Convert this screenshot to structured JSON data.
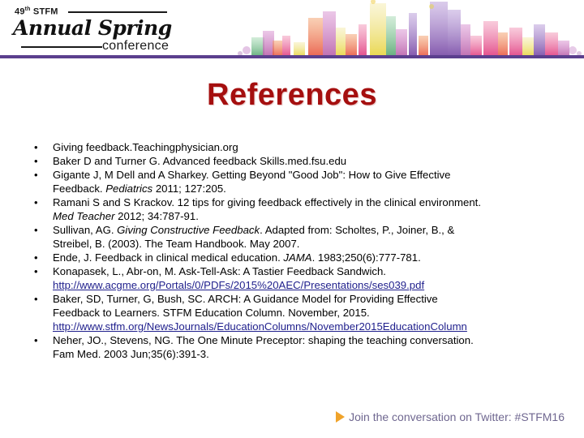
{
  "header": {
    "logo": {
      "ordinal": "49",
      "ordinal_suffix": "th",
      "org": "STFM",
      "script": "Annual Spring",
      "conference": "conference"
    },
    "graphic_name": "watercolor-city-skyline",
    "rule_color": "#5b3f8e"
  },
  "slide": {
    "title": "References",
    "title_color": "#a50f0f"
  },
  "references": [
    {
      "bullet": "•",
      "lines": [
        [
          {
            "text": "Giving  feedback.Teachingphysician.org",
            "style": "plain"
          }
        ]
      ]
    },
    {
      "bullet": "•",
      "lines": [
        [
          {
            "text": "Baker D and Turner G. Advanced feedback Skills.med.fsu.edu",
            "style": "plain"
          }
        ]
      ]
    },
    {
      "bullet": "•",
      "lines": [
        [
          {
            "text": "Gigante J, M Dell and A Sharkey. Getting Beyond \"Good Job\": How to Give Effective",
            "style": "plain"
          }
        ],
        [
          {
            "text": "Feedback. ",
            "style": "plain"
          },
          {
            "text": "Pediatrics",
            "style": "italic"
          },
          {
            "text": " 2011; 127:205.",
            "style": "plain"
          }
        ]
      ]
    },
    {
      "bullet": "•",
      "lines": [
        [
          {
            "text": "Ramani S and S Krackov. 12 tips for giving feedback effectively in the clinical environment.",
            "style": "plain"
          }
        ],
        [
          {
            "text": "Med Teacher",
            "style": "italic"
          },
          {
            "text": " 2012; 34:787-91.",
            "style": "plain"
          }
        ]
      ]
    },
    {
      "bullet": "•",
      "lines": [
        [
          {
            "text": "Sullivan, AG. ",
            "style": "plain"
          },
          {
            "text": "Giving Constructive Feedback",
            "style": "italic"
          },
          {
            "text": ". Adapted from: Scholtes, P., Joiner, B., &",
            "style": "plain"
          }
        ],
        [
          {
            "text": "Streibel, B. (2003). The Team Handbook. May 2007.",
            "style": "plain"
          }
        ]
      ]
    },
    {
      "bullet": "•",
      "lines": [
        [
          {
            "text": "Ende, J.  Feedback in clinical medical education. ",
            "style": "plain"
          },
          {
            "text": "JAMA",
            "style": "italic"
          },
          {
            "text": ". 1983;250(6):777-781.",
            "style": "plain"
          }
        ]
      ]
    },
    {
      "bullet": "•",
      "lines": [
        [
          {
            "text": "Konapasek, L., Abr-on, M.  Ask-Tell-Ask:  A Tastier Feedback Sandwich.",
            "style": "plain"
          }
        ],
        [
          {
            "text": "http://www.acgme.org/Portals/0/PDFs/2015%20AEC/Presentations/ses039.pdf",
            "style": "link"
          }
        ]
      ]
    },
    {
      "bullet": "•",
      "lines": [
        [
          {
            "text": "Baker, SD, Turner, G, Bush, SC. ARCH: A Guidance Model for Providing Effective",
            "style": "plain"
          }
        ],
        [
          {
            "text": "Feedback to Learners. STFM Education Column. November, 2015.",
            "style": "plain"
          }
        ],
        [
          {
            "text": "http://www.stfm.org/NewsJournals/EducationColumns/November2015EducationColumn",
            "style": "link"
          }
        ]
      ]
    },
    {
      "bullet": "•",
      "lines": [
        [
          {
            "text": "Neher, JO., Stevens, NG.  The One Minute Preceptor: shaping the teaching conversation.",
            "style": "plain"
          }
        ],
        [
          {
            "text": "Fam Med. 2003 Jun;35(6):391-3.",
            "style": "plain"
          }
        ]
      ]
    }
  ],
  "footer": {
    "icon": "play-triangle-icon",
    "icon_color": "#f0a32a",
    "text": "Join the conversation on Twitter: #STFM16",
    "text_color": "#6f6790"
  }
}
